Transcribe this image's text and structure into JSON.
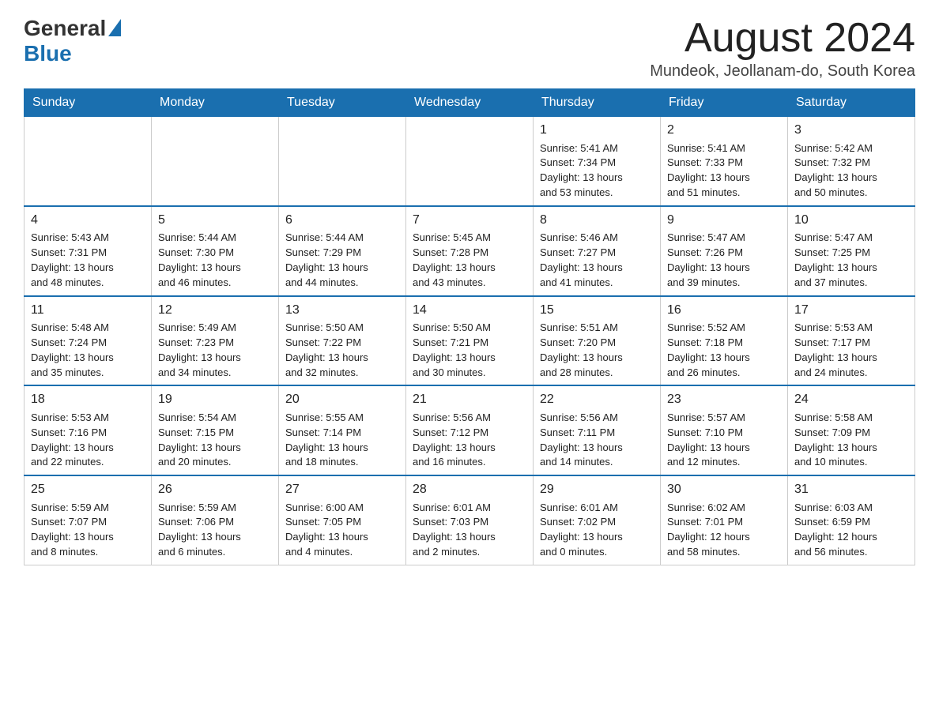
{
  "logo": {
    "general": "General",
    "blue": "Blue"
  },
  "title": {
    "month_year": "August 2024",
    "location": "Mundeok, Jeollanam-do, South Korea"
  },
  "days_of_week": [
    "Sunday",
    "Monday",
    "Tuesday",
    "Wednesday",
    "Thursday",
    "Friday",
    "Saturday"
  ],
  "weeks": [
    [
      {
        "day": "",
        "info": ""
      },
      {
        "day": "",
        "info": ""
      },
      {
        "day": "",
        "info": ""
      },
      {
        "day": "",
        "info": ""
      },
      {
        "day": "1",
        "info": "Sunrise: 5:41 AM\nSunset: 7:34 PM\nDaylight: 13 hours\nand 53 minutes."
      },
      {
        "day": "2",
        "info": "Sunrise: 5:41 AM\nSunset: 7:33 PM\nDaylight: 13 hours\nand 51 minutes."
      },
      {
        "day": "3",
        "info": "Sunrise: 5:42 AM\nSunset: 7:32 PM\nDaylight: 13 hours\nand 50 minutes."
      }
    ],
    [
      {
        "day": "4",
        "info": "Sunrise: 5:43 AM\nSunset: 7:31 PM\nDaylight: 13 hours\nand 48 minutes."
      },
      {
        "day": "5",
        "info": "Sunrise: 5:44 AM\nSunset: 7:30 PM\nDaylight: 13 hours\nand 46 minutes."
      },
      {
        "day": "6",
        "info": "Sunrise: 5:44 AM\nSunset: 7:29 PM\nDaylight: 13 hours\nand 44 minutes."
      },
      {
        "day": "7",
        "info": "Sunrise: 5:45 AM\nSunset: 7:28 PM\nDaylight: 13 hours\nand 43 minutes."
      },
      {
        "day": "8",
        "info": "Sunrise: 5:46 AM\nSunset: 7:27 PM\nDaylight: 13 hours\nand 41 minutes."
      },
      {
        "day": "9",
        "info": "Sunrise: 5:47 AM\nSunset: 7:26 PM\nDaylight: 13 hours\nand 39 minutes."
      },
      {
        "day": "10",
        "info": "Sunrise: 5:47 AM\nSunset: 7:25 PM\nDaylight: 13 hours\nand 37 minutes."
      }
    ],
    [
      {
        "day": "11",
        "info": "Sunrise: 5:48 AM\nSunset: 7:24 PM\nDaylight: 13 hours\nand 35 minutes."
      },
      {
        "day": "12",
        "info": "Sunrise: 5:49 AM\nSunset: 7:23 PM\nDaylight: 13 hours\nand 34 minutes."
      },
      {
        "day": "13",
        "info": "Sunrise: 5:50 AM\nSunset: 7:22 PM\nDaylight: 13 hours\nand 32 minutes."
      },
      {
        "day": "14",
        "info": "Sunrise: 5:50 AM\nSunset: 7:21 PM\nDaylight: 13 hours\nand 30 minutes."
      },
      {
        "day": "15",
        "info": "Sunrise: 5:51 AM\nSunset: 7:20 PM\nDaylight: 13 hours\nand 28 minutes."
      },
      {
        "day": "16",
        "info": "Sunrise: 5:52 AM\nSunset: 7:18 PM\nDaylight: 13 hours\nand 26 minutes."
      },
      {
        "day": "17",
        "info": "Sunrise: 5:53 AM\nSunset: 7:17 PM\nDaylight: 13 hours\nand 24 minutes."
      }
    ],
    [
      {
        "day": "18",
        "info": "Sunrise: 5:53 AM\nSunset: 7:16 PM\nDaylight: 13 hours\nand 22 minutes."
      },
      {
        "day": "19",
        "info": "Sunrise: 5:54 AM\nSunset: 7:15 PM\nDaylight: 13 hours\nand 20 minutes."
      },
      {
        "day": "20",
        "info": "Sunrise: 5:55 AM\nSunset: 7:14 PM\nDaylight: 13 hours\nand 18 minutes."
      },
      {
        "day": "21",
        "info": "Sunrise: 5:56 AM\nSunset: 7:12 PM\nDaylight: 13 hours\nand 16 minutes."
      },
      {
        "day": "22",
        "info": "Sunrise: 5:56 AM\nSunset: 7:11 PM\nDaylight: 13 hours\nand 14 minutes."
      },
      {
        "day": "23",
        "info": "Sunrise: 5:57 AM\nSunset: 7:10 PM\nDaylight: 13 hours\nand 12 minutes."
      },
      {
        "day": "24",
        "info": "Sunrise: 5:58 AM\nSunset: 7:09 PM\nDaylight: 13 hours\nand 10 minutes."
      }
    ],
    [
      {
        "day": "25",
        "info": "Sunrise: 5:59 AM\nSunset: 7:07 PM\nDaylight: 13 hours\nand 8 minutes."
      },
      {
        "day": "26",
        "info": "Sunrise: 5:59 AM\nSunset: 7:06 PM\nDaylight: 13 hours\nand 6 minutes."
      },
      {
        "day": "27",
        "info": "Sunrise: 6:00 AM\nSunset: 7:05 PM\nDaylight: 13 hours\nand 4 minutes."
      },
      {
        "day": "28",
        "info": "Sunrise: 6:01 AM\nSunset: 7:03 PM\nDaylight: 13 hours\nand 2 minutes."
      },
      {
        "day": "29",
        "info": "Sunrise: 6:01 AM\nSunset: 7:02 PM\nDaylight: 13 hours\nand 0 minutes."
      },
      {
        "day": "30",
        "info": "Sunrise: 6:02 AM\nSunset: 7:01 PM\nDaylight: 12 hours\nand 58 minutes."
      },
      {
        "day": "31",
        "info": "Sunrise: 6:03 AM\nSunset: 6:59 PM\nDaylight: 12 hours\nand 56 minutes."
      }
    ]
  ]
}
